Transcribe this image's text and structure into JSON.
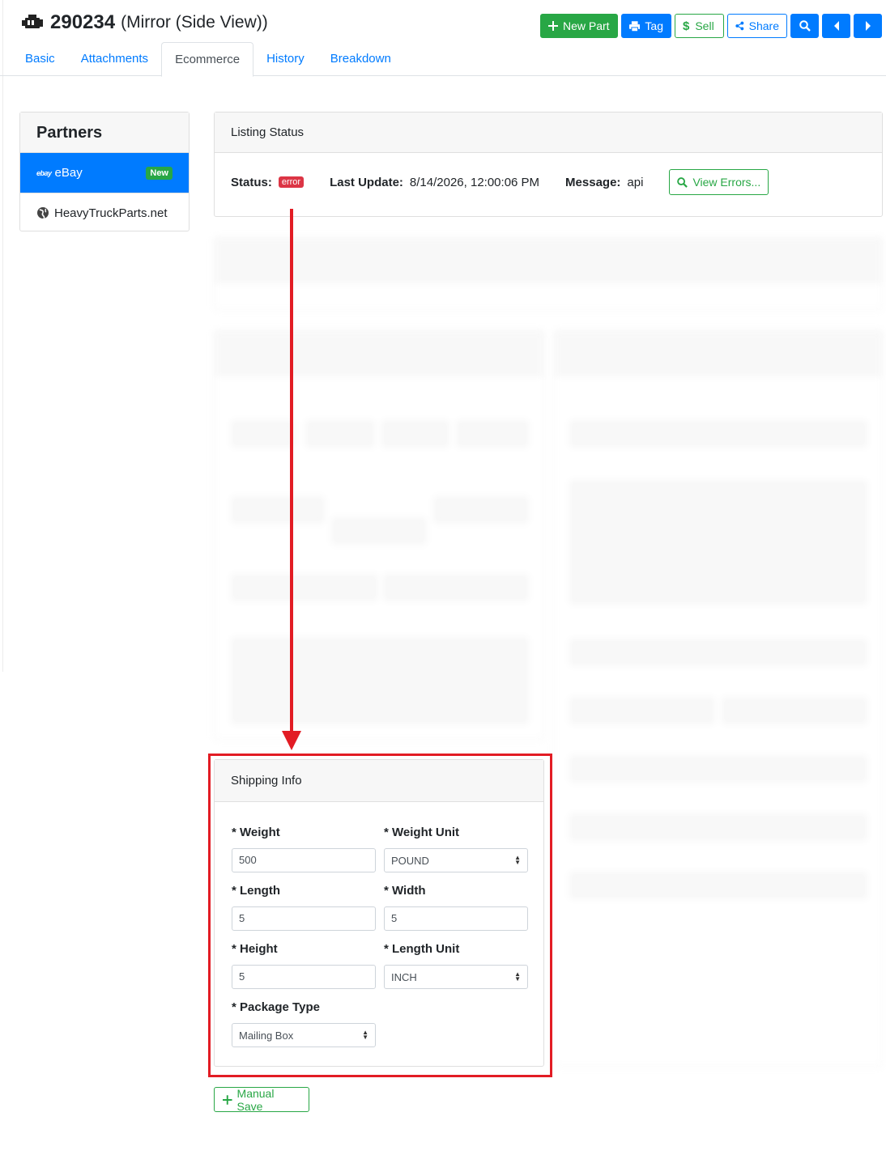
{
  "header": {
    "part_number": "290234",
    "part_name": "(Mirror (Side View))",
    "buttons": {
      "new_part": "New Part",
      "tag": "Tag",
      "sell": "Sell",
      "share": "Share"
    }
  },
  "tabs": [
    {
      "label": "Basic"
    },
    {
      "label": "Attachments"
    },
    {
      "label": "Ecommerce"
    },
    {
      "label": "History"
    },
    {
      "label": "Breakdown"
    }
  ],
  "partners": {
    "title": "Partners",
    "items": [
      {
        "logo": "ebay",
        "label": "eBay",
        "badge": "New"
      },
      {
        "label": "HeavyTruckParts.net"
      }
    ]
  },
  "listing_status": {
    "title": "Listing Status",
    "status_label": "Status:",
    "status_value": "error",
    "last_update_label": "Last Update:",
    "last_update_value": "8/14/2026, 12:00:06 PM",
    "message_label": "Message:",
    "message_value": "api",
    "view_errors": "View Errors..."
  },
  "shipping": {
    "title": "Shipping Info",
    "weight_label": "* Weight",
    "weight_value": "500",
    "weight_unit_label": "* Weight Unit",
    "weight_unit_value": "POUND",
    "length_label": "* Length",
    "length_value": "5",
    "width_label": "* Width",
    "width_value": "5",
    "height_label": "* Height",
    "height_value": "5",
    "length_unit_label": "* Length Unit",
    "length_unit_value": "INCH",
    "package_type_label": "* Package Type",
    "package_type_value": "Mailing Box"
  },
  "manual_save": "Manual Save",
  "colors": {
    "primary": "#007bff",
    "success": "#28a745",
    "danger": "#dc3545",
    "annotation": "#e21c24"
  }
}
